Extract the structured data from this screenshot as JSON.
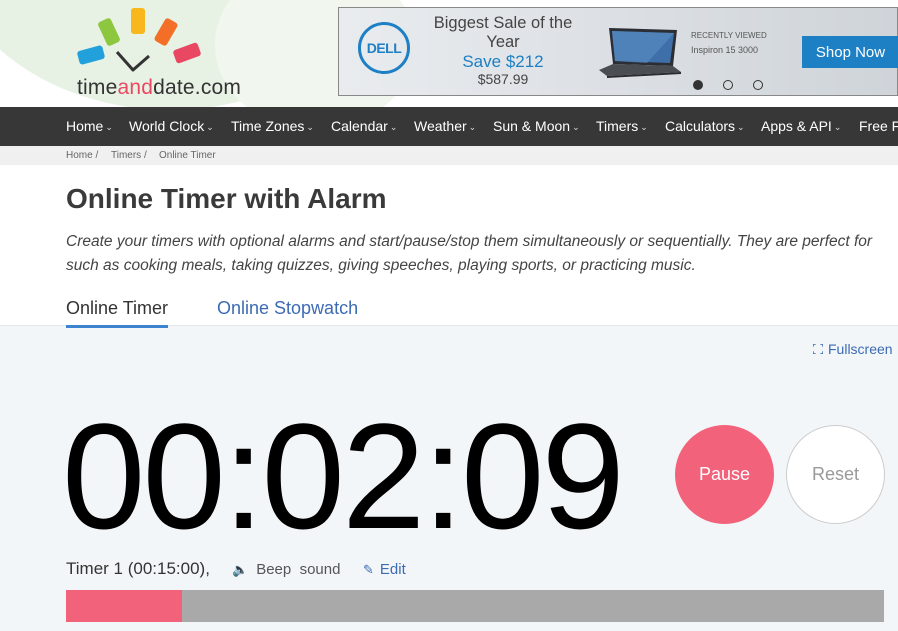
{
  "header": {
    "logo_text_time": "time",
    "logo_text_and": "and",
    "logo_text_date": "date.com",
    "logo_bar_colors": [
      "#21a0db",
      "#8dc63f",
      "#f7b71d",
      "#f36f27",
      "#e94862"
    ]
  },
  "ad": {
    "brand": "DELL",
    "title": "Biggest Sale of the Year",
    "save": "Save $212",
    "price": "$587.99",
    "recent": "RECENTLY VIEWED",
    "model": "Inspiron 15 3000",
    "cta": "Shop Now",
    "active_slide": 1,
    "slide_count": 3
  },
  "nav": {
    "items": [
      {
        "label": "Home"
      },
      {
        "label": "World Clock"
      },
      {
        "label": "Time Zones"
      },
      {
        "label": "Calendar"
      },
      {
        "label": "Weather"
      },
      {
        "label": "Sun & Moon"
      },
      {
        "label": "Timers"
      },
      {
        "label": "Calculators"
      },
      {
        "label": "Apps & API"
      },
      {
        "label": "Free F"
      }
    ]
  },
  "breadcrumb": [
    "Home /",
    "Timers /",
    "Online Timer"
  ],
  "page": {
    "title": "Online Timer with Alarm",
    "desc_line1": "Create your timers with optional alarms and start/pause/stop them simultaneously or sequentially. They are perfect for",
    "desc_line2": "such as cooking meals, taking quizzes, giving speeches, playing sports, or practicing music."
  },
  "tabs": [
    {
      "label": "Online Timer",
      "active": true
    },
    {
      "label": "Online Stopwatch",
      "active": false
    }
  ],
  "timer": {
    "fullscreen_label": "Fullscreen",
    "display": "00:02:09",
    "pause_label": "Pause",
    "reset_label": "Reset",
    "info": "Timer 1 (00:15:00),",
    "sound_word1": "Beep",
    "sound_word2": "sound",
    "edit_label": "Edit",
    "progress_fraction": 0.142
  },
  "colors": {
    "accent_pink": "#f2627a",
    "link_blue": "#3c6bb4",
    "nav_bg": "#373737"
  }
}
